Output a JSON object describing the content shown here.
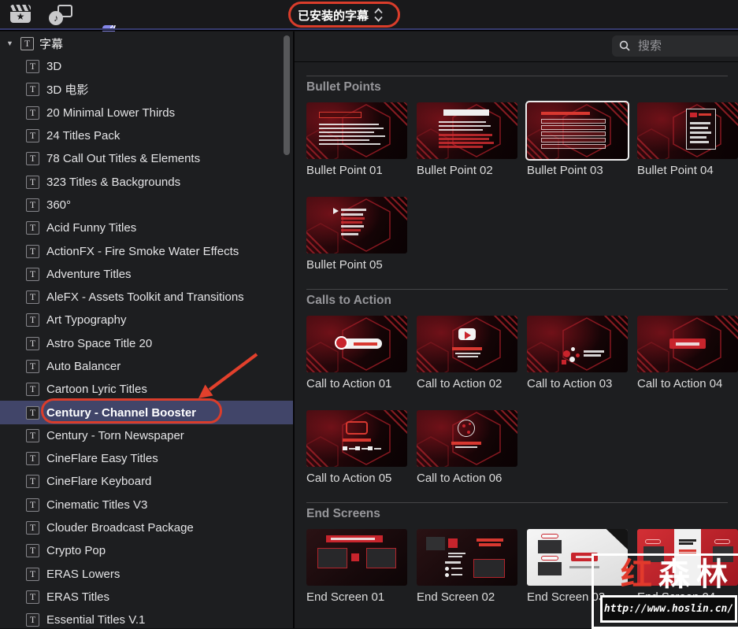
{
  "toolbar": {
    "dropdown_label": "已安装的字幕",
    "icons": [
      {
        "name": "effects-browser-icon"
      },
      {
        "name": "photos-audio-icon"
      },
      {
        "name": "titles-generators-icon"
      }
    ]
  },
  "search": {
    "placeholder": "搜索"
  },
  "sidebar": {
    "root_label": "字幕",
    "items": [
      {
        "label": "3D"
      },
      {
        "label": "3D 电影"
      },
      {
        "label": "20 Minimal Lower Thirds"
      },
      {
        "label": "24 Titles Pack"
      },
      {
        "label": "78 Call Out Titles & Elements"
      },
      {
        "label": "323 Titles & Backgrounds"
      },
      {
        "label": "360°"
      },
      {
        "label": "Acid Funny Titles"
      },
      {
        "label": "ActionFX - Fire Smoke Water Effects"
      },
      {
        "label": "Adventure Titles"
      },
      {
        "label": "AleFX - Assets Toolkit and Transitions"
      },
      {
        "label": "Art Typography"
      },
      {
        "label": "Astro Space Title 20"
      },
      {
        "label": "Auto Balancer"
      },
      {
        "label": "Cartoon Lyric Titles"
      },
      {
        "label": "Century - Channel Booster",
        "selected": true
      },
      {
        "label": "Century - Torn Newspaper"
      },
      {
        "label": "CineFlare Easy Titles"
      },
      {
        "label": "CineFlare Keyboard"
      },
      {
        "label": "Cinematic Titles V3"
      },
      {
        "label": "Clouder Broadcast Package"
      },
      {
        "label": "Crypto Pop"
      },
      {
        "label": "ERAS Lowers"
      },
      {
        "label": "ERAS Titles"
      },
      {
        "label": "Essential Titles V.1"
      }
    ]
  },
  "sections": [
    {
      "title": "Bullet Points",
      "items": [
        {
          "label": "Bullet Point 01",
          "variant": "bp1"
        },
        {
          "label": "Bullet Point 02",
          "variant": "bp2"
        },
        {
          "label": "Bullet Point 03",
          "variant": "bp3",
          "selected": true
        },
        {
          "label": "Bullet Point 04",
          "variant": "bp4"
        },
        {
          "label": "Bullet Point 05",
          "variant": "bp5"
        }
      ]
    },
    {
      "title": "Calls to Action",
      "items": [
        {
          "label": "Call to Action 01",
          "variant": "cta1"
        },
        {
          "label": "Call to Action 02",
          "variant": "cta2"
        },
        {
          "label": "Call to Action 03",
          "variant": "cta3"
        },
        {
          "label": "Call to Action 04",
          "variant": "cta4"
        },
        {
          "label": "Call to Action 05",
          "variant": "cta5"
        },
        {
          "label": "Call to Action 06",
          "variant": "cta6"
        }
      ]
    },
    {
      "title": "End Screens",
      "items": [
        {
          "label": "End Screen 01",
          "variant": "es1"
        },
        {
          "label": "End Screen 02",
          "variant": "es2"
        },
        {
          "label": "End Screen 03",
          "variant": "es3"
        },
        {
          "label": "End Screen 04",
          "variant": "es4"
        }
      ]
    }
  ],
  "watermark": {
    "brand": "红森林",
    "url": "http://www.hoslin.cn/"
  },
  "colors": {
    "selection_blue": "#414569",
    "annotation_red": "#da3d2b",
    "thumb_red": "#c8242c",
    "topbar_accent": "#383c6f"
  }
}
